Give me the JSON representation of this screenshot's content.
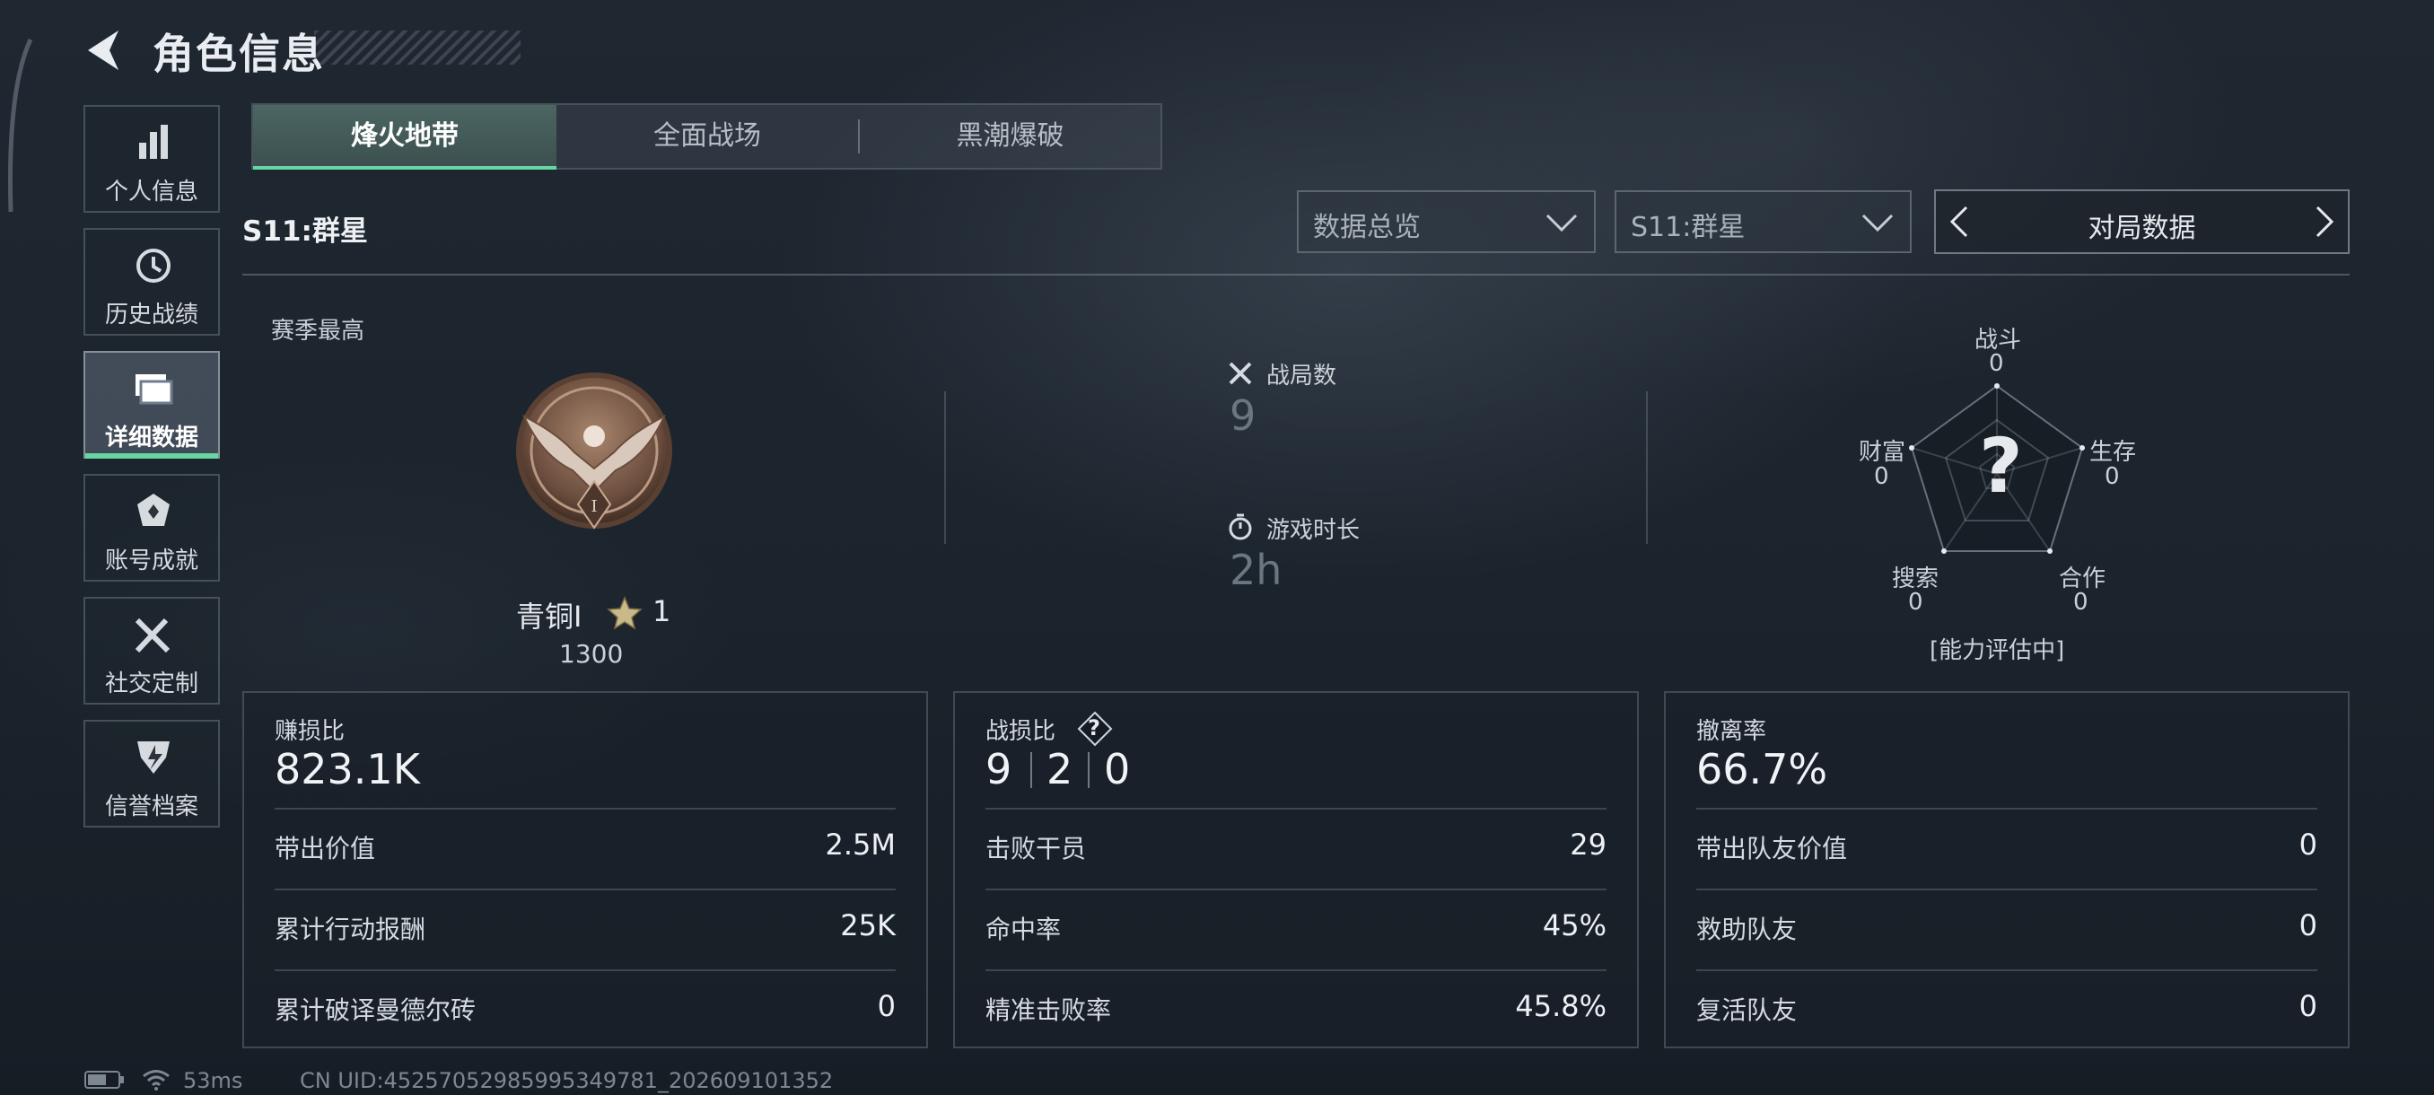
{
  "header": {
    "title": "角色信息"
  },
  "sidebar": {
    "items": [
      {
        "label": "个人信息",
        "icon": "bar-chart-icon"
      },
      {
        "label": "历史战绩",
        "icon": "history-icon"
      },
      {
        "label": "详细数据",
        "icon": "folders-icon",
        "active": true
      },
      {
        "label": "账号成就",
        "icon": "achievement-icon"
      },
      {
        "label": "社交定制",
        "icon": "wrench-icon"
      },
      {
        "label": "信誉档案",
        "icon": "shield-bolt-icon"
      }
    ]
  },
  "tabs": [
    {
      "label": "烽火地带",
      "active": true
    },
    {
      "label": "全面战场"
    },
    {
      "label": "黑潮爆破"
    }
  ],
  "season": {
    "label": "S11:群星"
  },
  "filters": {
    "overview": "数据总览",
    "season": "S11:群星",
    "match_data": "对局数据"
  },
  "rank": {
    "heading": "赛季最高",
    "name": "青铜I",
    "stars": "1",
    "score": "1300"
  },
  "stats": {
    "matches_label": "战局数",
    "matches_value": "9",
    "time_label": "游戏时长",
    "time_value": "2h"
  },
  "radar": {
    "center": "?",
    "combat": {
      "label": "战斗",
      "value": "0"
    },
    "survival": {
      "label": "生存",
      "value": "0"
    },
    "coop": {
      "label": "合作",
      "value": "0"
    },
    "search": {
      "label": "搜索",
      "value": "0"
    },
    "wealth": {
      "label": "财富",
      "value": "0"
    },
    "status": "[能力评估中]"
  },
  "panels": {
    "profit": {
      "title": "赚损比",
      "value": "823.1K",
      "rows": [
        {
          "label": "带出价值",
          "value": "2.5M"
        },
        {
          "label": "累计行动报酬",
          "value": "25K"
        },
        {
          "label": "累计破译曼德尔砖",
          "value": "0"
        }
      ]
    },
    "combat": {
      "title": "战损比",
      "help": "?",
      "values": [
        "9",
        "2",
        "0"
      ],
      "rows": [
        {
          "label": "击败干员",
          "value": "29"
        },
        {
          "label": "命中率",
          "value": "45%"
        },
        {
          "label": "精准击败率",
          "value": "45.8%"
        }
      ]
    },
    "extract": {
      "title": "撤离率",
      "value": "66.7%",
      "rows": [
        {
          "label": "带出队友价值",
          "value": "0"
        },
        {
          "label": "救助队友",
          "value": "0"
        },
        {
          "label": "复活队友",
          "value": "0"
        }
      ]
    }
  },
  "status_bar": {
    "ping": "53ms",
    "uid": "CN UID:452570529859953497​81_202609101352"
  }
}
